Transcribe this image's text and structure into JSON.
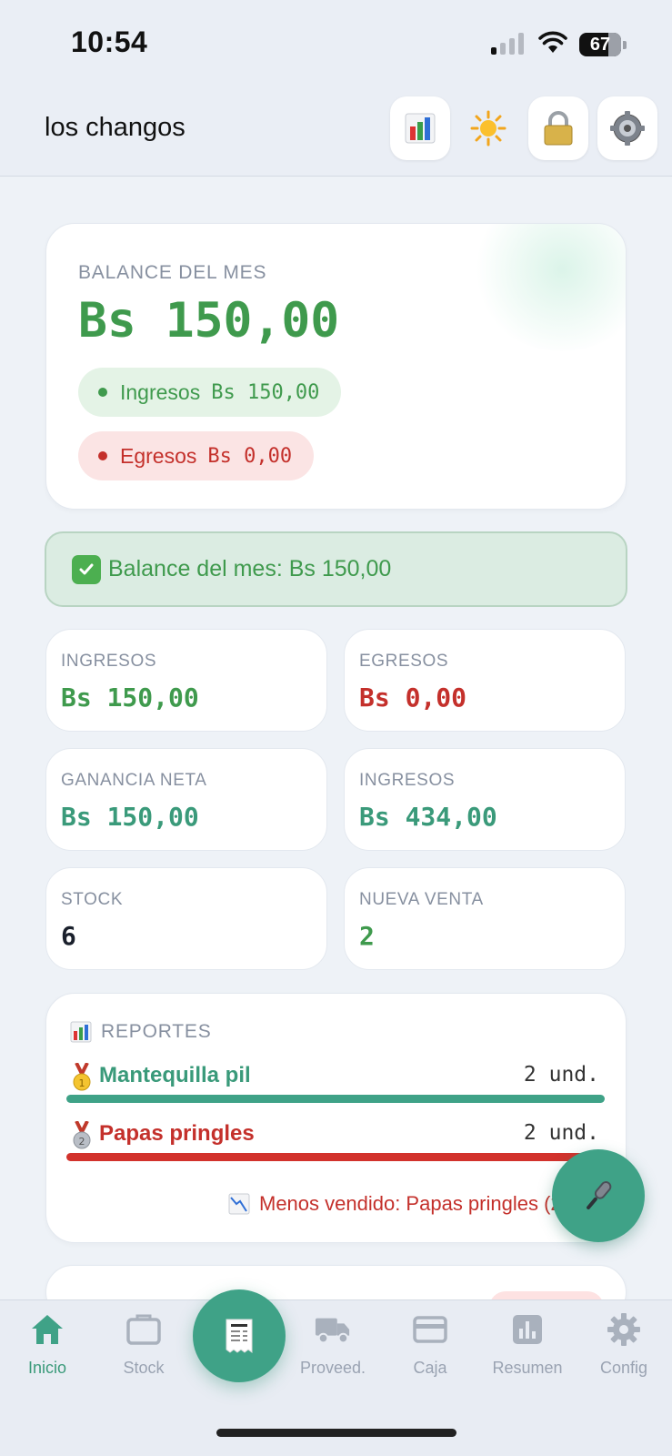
{
  "status_bar": {
    "time": "10:54",
    "battery": "67"
  },
  "header": {
    "title": "los changos",
    "icons": [
      "bar-chart-icon",
      "sun-icon",
      "lock-icon",
      "gear-icon"
    ]
  },
  "balance": {
    "label": "BALANCE DEL MES",
    "value": "Bs 150,00",
    "income_label": "Ingresos",
    "income_value": "Bs 150,00",
    "expense_label": "Egresos",
    "expense_value": "Bs 0,00"
  },
  "alert": {
    "text": "Balance del mes: Bs 150,00"
  },
  "stats": [
    {
      "label": "INGRESOS",
      "value": "Bs 150,00",
      "color": "#3f9a4d"
    },
    {
      "label": "EGRESOS",
      "value": "Bs 0,00",
      "color": "#c4302b"
    },
    {
      "label": "GANANCIA NETA",
      "value": "Bs 150,00",
      "color": "#3a9a7a"
    },
    {
      "label": "INGRESOS",
      "value": "Bs 434,00",
      "color": "#3a9a7a"
    },
    {
      "label": "STOCK",
      "value": "6",
      "color": "#1a202c"
    },
    {
      "label": "NUEVA VENTA",
      "value": "2",
      "color": "#3f9a4d"
    }
  ],
  "reports": {
    "title": "REPORTES",
    "items": [
      {
        "rank": 1,
        "name": "Mantequilla pil",
        "qty": "2 und.",
        "fill": 1.0,
        "color": "#3fa287"
      },
      {
        "rank": 2,
        "name": "Papas pringles",
        "qty": "2 und.",
        "fill": 1.0,
        "color": "#d2322c"
      }
    ],
    "least_sold": "Menos vendido: Papas pringles (2"
  },
  "nav": {
    "items": [
      {
        "label": "Inicio",
        "icon": "home-icon",
        "active": true
      },
      {
        "label": "Stock",
        "icon": "box-icon",
        "active": false
      },
      {
        "label": "Proveed.",
        "icon": "truck-icon",
        "active": false
      },
      {
        "label": "Caja",
        "icon": "card-icon",
        "active": false
      },
      {
        "label": "Resumen",
        "icon": "chart-icon",
        "active": false
      },
      {
        "label": "Config",
        "icon": "gear-icon",
        "active": false
      }
    ],
    "center_icon": "receipt-icon"
  },
  "colors": {
    "accent": "#3fa287",
    "income": "#3f9a4d",
    "expense": "#c4302b",
    "neutral_label": "#8790a0"
  }
}
